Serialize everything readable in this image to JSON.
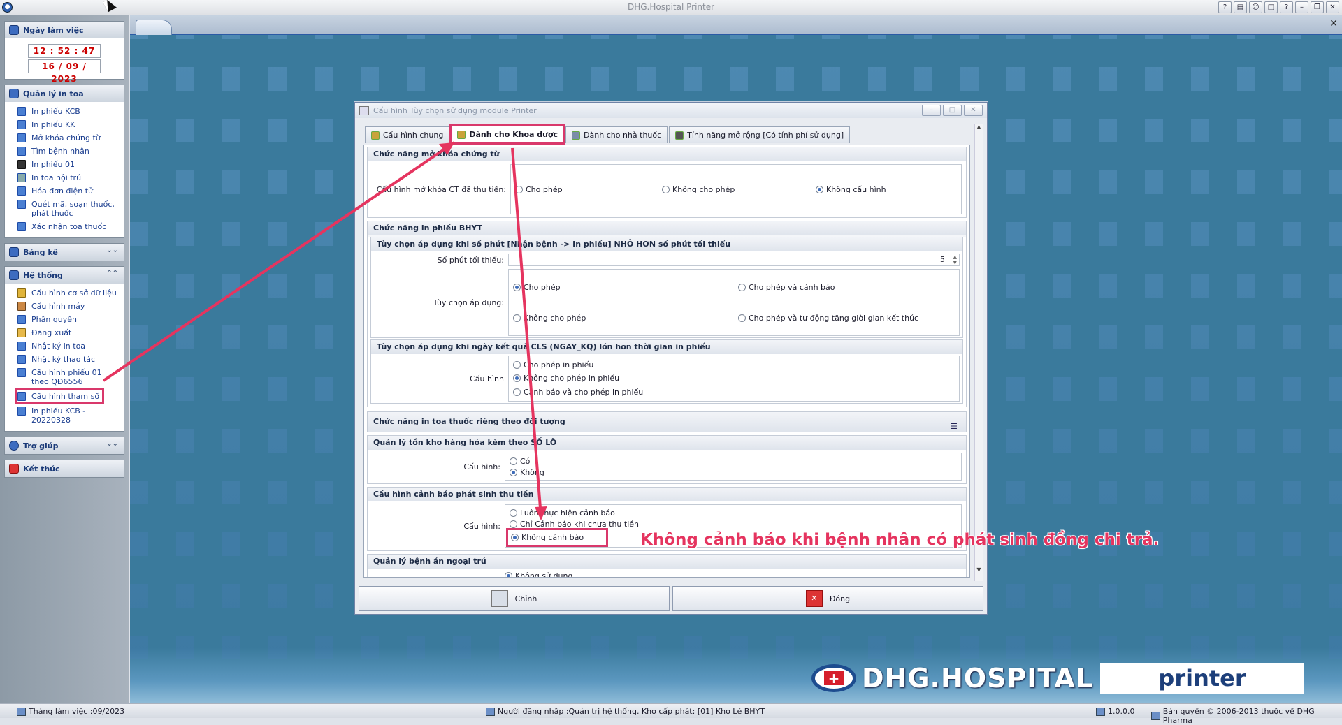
{
  "window": {
    "title": "DHG.Hospital Printer"
  },
  "sidebar": {
    "workday": {
      "title": "Ngày làm việc",
      "time": "12 : 52 : 47",
      "date": "16 / 09 / 2023"
    },
    "print_mgmt": {
      "title": "Quản lý in toa",
      "items": [
        "In phiếu KCB",
        "In phiếu KK",
        "Mở khóa chứng từ",
        "Tìm bệnh nhân",
        "In phiếu 01",
        "In toa nội trú",
        "Hóa đơn điện tử",
        "Quét mã, soạn thuốc, phát thuốc",
        "Xác nhận toa thuốc"
      ]
    },
    "report": {
      "title": "Bảng kê"
    },
    "system": {
      "title": "Hệ thống",
      "items": [
        "Cấu hình cơ sở dữ liệu",
        "Cấu hình máy",
        "Phân quyền",
        "Đăng xuất",
        "Nhật ký in toa",
        "Nhật ký thao tác",
        "Cấu hình phiếu 01 theo QĐ6556",
        "Cấu hình tham số",
        "In phiếu KCB - 20220328"
      ]
    },
    "help": {
      "title": "Trợ giúp"
    },
    "exit": {
      "title": "Kết thúc"
    }
  },
  "dialog": {
    "title": "Cấu hình Tùy chọn sử dụng module Printer",
    "tabs": [
      "Cấu hình chung",
      "Dành cho Khoa dược",
      "Dành cho nhà thuốc",
      "Tính năng mở rộng [Có tính phí sử dụng]"
    ],
    "g1": {
      "title": "Chức năng mở khóa chứng từ",
      "label": "Cấu hình mở khóa CT đã thu tiền:",
      "options": [
        "Cho phép",
        "Không cho phép",
        "Không cấu hình"
      ],
      "selected": "Không cấu hình"
    },
    "g2": {
      "title": "Chức năng in phiếu BHYT",
      "sub1": {
        "title": "Tùy chọn áp dụng khi  số phút [Nhận bệnh -> In phiếu] NHỎ HƠN số phút tối thiểu",
        "min_label": "Số phút tối thiểu:",
        "min_value": "5",
        "opt_label": "Tùy chọn áp dụng:",
        "options": [
          "Cho phép",
          "Cho phép và cảnh báo",
          "Không cho phép",
          "Cho phép và tự động tăng giời gian kết thúc"
        ],
        "selected": "Cho phép"
      },
      "sub2": {
        "title": "Tùy chọn áp dụng khi ngày kết quả CLS (NGAY_KQ) lớn hơn thời gian in phiếu",
        "label": "Cấu hình",
        "options": [
          "Cho phép in phiếu",
          "Không cho phép in phiếu",
          "Cảnh báo và cho phép in phiếu"
        ],
        "selected": "Không cho phép in phiếu"
      }
    },
    "g3": {
      "title": "Chức năng in toa thuốc riêng theo đối tượng"
    },
    "g4": {
      "title": "Quản lý tồn kho hàng hóa kèm theo SỐ LÔ",
      "label": "Cấu hình:",
      "options": [
        "Có",
        "Không"
      ],
      "selected": "Không"
    },
    "g5": {
      "title": "Cấu hình cảnh báo phát sinh thu tiền",
      "label": "Cấu hình:",
      "options": [
        "Luôn thực hiện cảnh báo",
        "Chỉ Cảnh báo khi chưa thu tiền",
        "Không cảnh báo"
      ],
      "selected": "Không cảnh báo"
    },
    "g6": {
      "title": "Quản lý bệnh án ngoại trú",
      "options": [
        "Không sử dụng"
      ]
    },
    "buttons": {
      "edit": "Chỉnh",
      "close": "Đóng"
    }
  },
  "annotation": "Không cảnh báo khi bệnh nhân có phát sinh đồng chi trả.",
  "logo": {
    "word": "DHG.HOSPITAL",
    "printer": "printer"
  },
  "status": {
    "month": "Tháng làm việc :09/2023",
    "login": "Người đăng nhập :Quản trị hệ thống. Kho cấp phát: [01] Kho Lẻ BHYT",
    "version": "1.0.0.0",
    "copyright": "Bản quyền © 2006-2013 thuộc về DHG Pharma"
  },
  "colors": {
    "accent": "#d9386b",
    "desktop": "#3a7a9c",
    "link": "#1a3d8f"
  }
}
